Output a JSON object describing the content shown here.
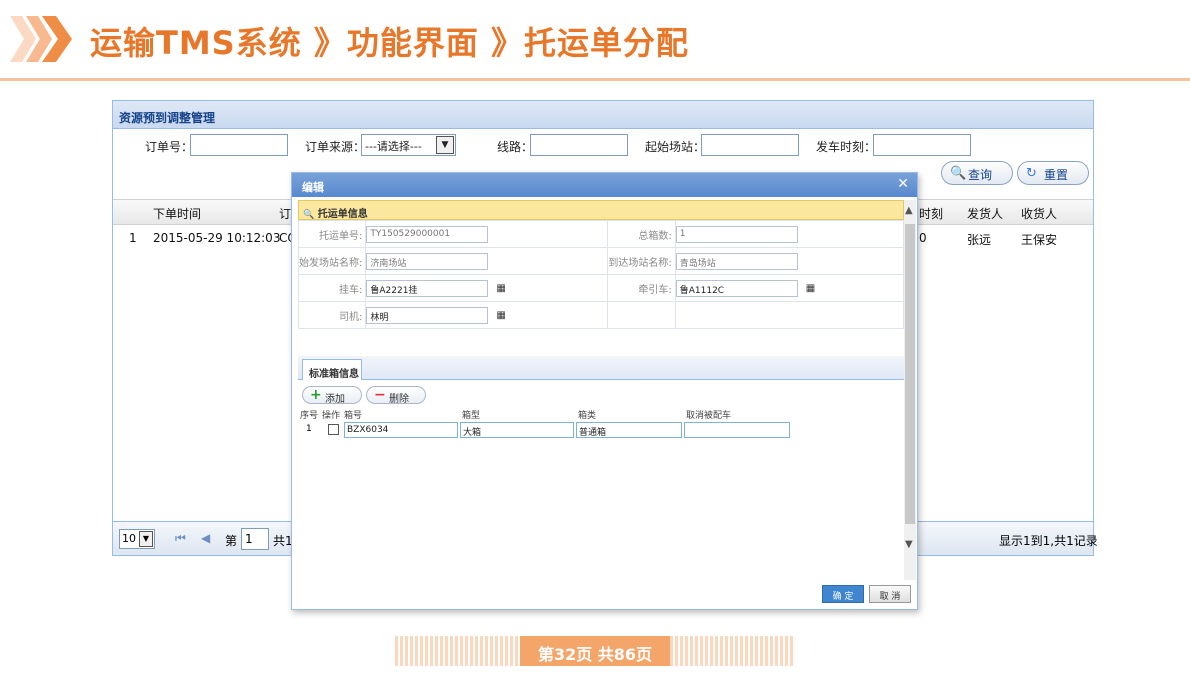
{
  "slide": {
    "title": "运输TMS系统 》功能界面 》托运单分配",
    "page_indicator": "第32页  共86页"
  },
  "panel": {
    "title": "资源预到调整管理",
    "filters": {
      "order_no_label": "订单号：",
      "order_source_label": "订单来源：",
      "order_source_value": "---请选择---",
      "route_label": "线路：",
      "start_station_label": "起始场站：",
      "depart_time_label": "发车时刻："
    },
    "buttons": {
      "query": "查询",
      "reset": "重置"
    },
    "grid": {
      "headers": [
        "下单时间",
        "订",
        "时刻",
        "发货人",
        "收货人"
      ],
      "rows": [
        {
          "index": "1",
          "order_time": "2015-05-29 10:12:03",
          "order_trunc": "CO",
          "time_trunc": "0",
          "shipper": "张远",
          "consignee": "王保安"
        }
      ]
    },
    "pager": {
      "page_size": "10",
      "page_label": "第",
      "page_value": "1",
      "total_label": "共1",
      "display_info": "显示1到1,共1记录"
    }
  },
  "dialog": {
    "title": "编辑",
    "section_title": "托运单信息",
    "form": {
      "waybill_no_label": "托运单号:",
      "waybill_no_value": "TY150529000001",
      "total_boxes_label": "总箱数:",
      "total_boxes_value": "1",
      "origin_station_label": "始发场站名称:",
      "origin_station_value": "济南场站",
      "dest_station_label": "到达场站名称:",
      "dest_station_value": "青岛场站",
      "trailer_label": "挂车:",
      "trailer_value": "鲁A2221挂",
      "tractor_label": "牵引车:",
      "tractor_value": "鲁A1112C",
      "driver_label": "司机:",
      "driver_value": "林明"
    },
    "tab_label": "标准箱信息",
    "add_button": "添加",
    "delete_button": "删除",
    "box_table": {
      "headers": [
        "序号",
        "操作",
        "箱号",
        "箱型",
        "箱类",
        "取消被配车"
      ],
      "rows": [
        {
          "index": "1",
          "box_no": "BZX6034",
          "box_type": "大箱",
          "box_class": "普通箱",
          "cancel": ""
        }
      ]
    },
    "ok_button": "确 定",
    "cancel_button": "取 消"
  }
}
